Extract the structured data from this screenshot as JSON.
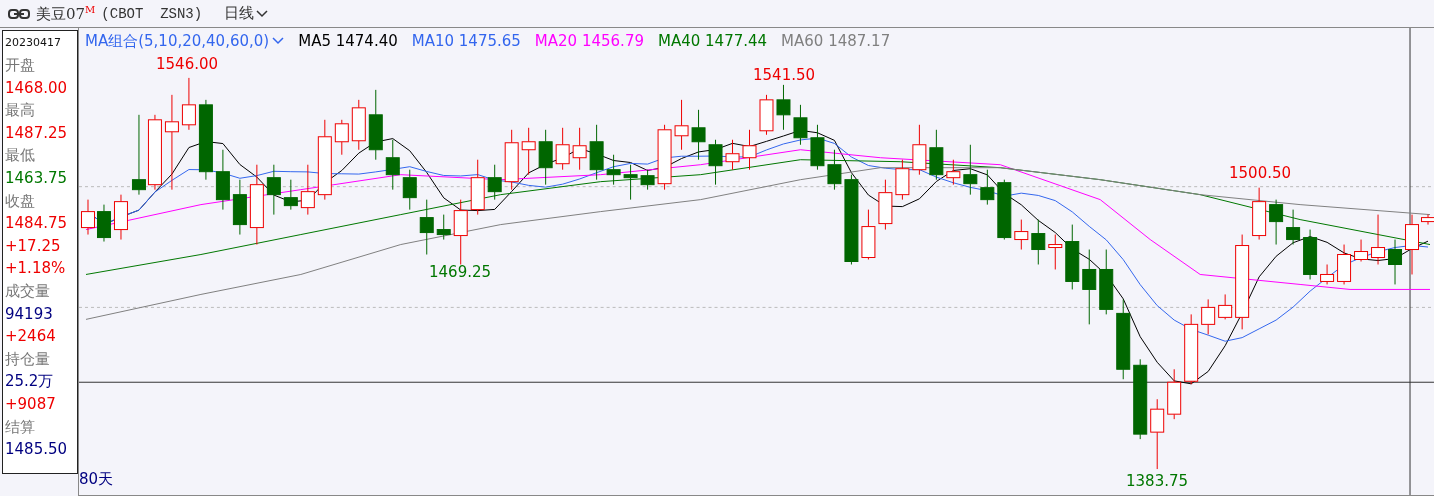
{
  "header": {
    "title": "美豆07",
    "superscript": "M",
    "code": "(CBOT  ZSN3)",
    "period": "日线"
  },
  "info_panel": {
    "date": "20230417",
    "rows": [
      {
        "kind": "label",
        "text": "开盘"
      },
      {
        "kind": "value",
        "text": "1468.00",
        "color": "#ee0000"
      },
      {
        "kind": "label",
        "text": "最高"
      },
      {
        "kind": "value",
        "text": "1487.25",
        "color": "#ee0000"
      },
      {
        "kind": "label",
        "text": "最低"
      },
      {
        "kind": "value",
        "text": "1463.75",
        "color": "#007700"
      },
      {
        "kind": "label",
        "text": "收盘"
      },
      {
        "kind": "value",
        "text": "1484.75",
        "color": "#ee0000"
      },
      {
        "kind": "value",
        "text": "+17.25",
        "color": "#ee0000"
      },
      {
        "kind": "value",
        "text": "+1.18%",
        "color": "#ee0000"
      },
      {
        "kind": "label",
        "text": "成交量"
      },
      {
        "kind": "value",
        "text": "94193",
        "color": "#000080"
      },
      {
        "kind": "value",
        "text": "+2464",
        "color": "#ee0000"
      },
      {
        "kind": "label",
        "text": "持仓量"
      },
      {
        "kind": "value",
        "text": "25.2万",
        "color": "#000080"
      },
      {
        "kind": "value",
        "text": "+9087",
        "color": "#ee0000"
      },
      {
        "kind": "label",
        "text": "结算"
      },
      {
        "kind": "value",
        "text": "1485.50",
        "color": "#000080"
      }
    ]
  },
  "legend": {
    "selector": "MA组合(5,10,20,40,60,0)",
    "lines": [
      {
        "name": "MA5",
        "value": "1474.40",
        "color": "#000000"
      },
      {
        "name": "MA10",
        "value": "1475.65",
        "color": "#3366ee"
      },
      {
        "name": "MA20",
        "value": "1456.79",
        "color": "#ff00ff"
      },
      {
        "name": "MA40",
        "value": "1477.44",
        "color": "#007700"
      },
      {
        "name": "MA60",
        "value": "1487.17",
        "color": "#808080"
      }
    ]
  },
  "annotations": [
    {
      "text": "1546.00",
      "kind": "high"
    },
    {
      "text": "1541.50",
      "kind": "high"
    },
    {
      "text": "1500.50",
      "kind": "high"
    },
    {
      "text": "1469.25",
      "kind": "low"
    },
    {
      "text": "1383.75",
      "kind": "low"
    }
  ],
  "footer": {
    "period_count": "80天"
  }
}
